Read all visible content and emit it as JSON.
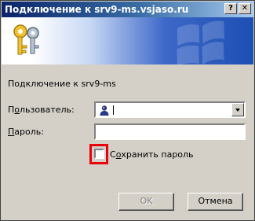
{
  "window": {
    "title": "Подключение к srv9-ms.vsjaso.ru"
  },
  "title_buttons": {
    "help": "?",
    "close": "✕"
  },
  "banner": {
    "icon": "keys-icon",
    "logo": "windows-logo"
  },
  "form": {
    "connect_text": "Подключение к srv9-ms",
    "user_label_prefix": "П",
    "user_label_accel": "о",
    "user_label_rest": "льзователь:",
    "user_value": "",
    "password_label_accel": "П",
    "password_label_rest": "ароль:",
    "password_value": "",
    "save_accel_prefix": "С",
    "save_accel": "о",
    "save_rest": "хранить пароль",
    "save_checked": false
  },
  "buttons": {
    "ok": "OK",
    "cancel": "Отмена"
  }
}
